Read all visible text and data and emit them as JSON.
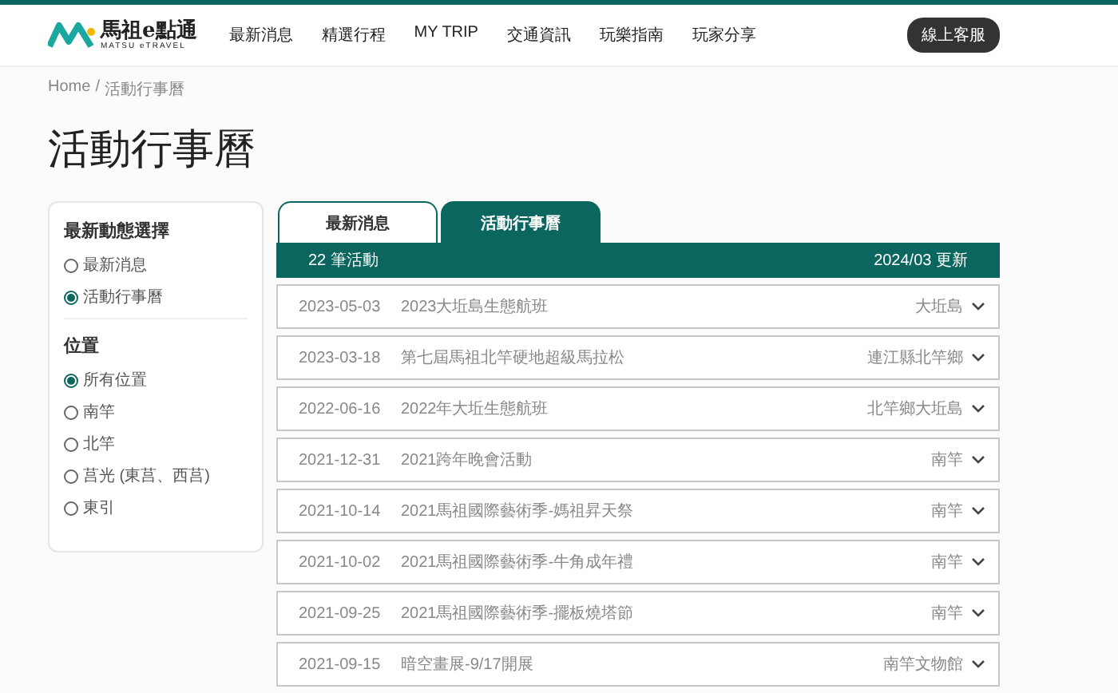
{
  "header": {
    "logo_text": "馬祖e點通",
    "logo_subtext": "MATSU eTRAVEL",
    "nav": [
      "最新消息",
      "精選行程",
      "MY TRIP",
      "交通資訊",
      "玩樂指南",
      "玩家分享"
    ],
    "service_button": "線上客服"
  },
  "breadcrumb": {
    "items": [
      "Home",
      "活動行事曆"
    ],
    "separator": "/"
  },
  "page_title": "活動行事曆",
  "sidebar": {
    "groups": [
      {
        "title": "最新動態選擇",
        "options": [
          {
            "label": "最新消息",
            "selected": false
          },
          {
            "label": "活動行事曆",
            "selected": true
          }
        ]
      },
      {
        "title": "位置",
        "options": [
          {
            "label": "所有位置",
            "selected": true
          },
          {
            "label": "南竿",
            "selected": false
          },
          {
            "label": "北竿",
            "selected": false
          },
          {
            "label": "莒光 (東莒、西莒)",
            "selected": false
          },
          {
            "label": "東引",
            "selected": false
          }
        ]
      }
    ]
  },
  "tabs": [
    {
      "label": "最新消息",
      "selected": false
    },
    {
      "label": "活動行事曆",
      "selected": true
    }
  ],
  "list_header": {
    "count": "22 筆活動",
    "updated": "2024/03 更新"
  },
  "events": [
    {
      "date": "2023-05-03",
      "title": "2023大坵島生態航班",
      "location": "大坵島"
    },
    {
      "date": "2023-03-18",
      "title": "第七屆馬祖北竿硬地超級馬拉松",
      "location": "連江縣北竿鄉"
    },
    {
      "date": "2022-06-16",
      "title": "2022年大坵生態航班",
      "location": "北竿鄉大坵島"
    },
    {
      "date": "2021-12-31",
      "title": "2021跨年晚會活動",
      "location": "南竿"
    },
    {
      "date": "2021-10-14",
      "title": "2021馬祖國際藝術季-媽祖昇天祭",
      "location": "南竿"
    },
    {
      "date": "2021-10-02",
      "title": "2021馬祖國際藝術季-牛角成年禮",
      "location": "南竿"
    },
    {
      "date": "2021-09-25",
      "title": "2021馬祖國際藝術季-擺板燒塔節",
      "location": "南竿"
    },
    {
      "date": "2021-09-15",
      "title": "暗空畫展-9/17開展",
      "location": "南竿文物館"
    }
  ]
}
